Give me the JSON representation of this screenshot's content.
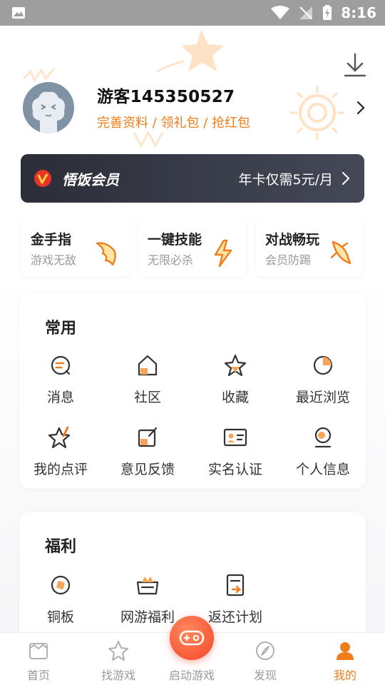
{
  "status_bar": {
    "time": "8:16"
  },
  "profile": {
    "username": "游客145350527",
    "subtitle": "完善资料 / 领礼包 / 抢红包"
  },
  "vip": {
    "title": "悟饭会员",
    "offer": "年卡仅需5元/月"
  },
  "features": [
    {
      "title": "金手指",
      "subtitle": "游戏无敌",
      "icon": "wing-icon"
    },
    {
      "title": "一键技能",
      "subtitle": "无限必杀",
      "icon": "lightning-icon"
    },
    {
      "title": "对战畅玩",
      "subtitle": "会员防踢",
      "icon": "rocket-icon"
    }
  ],
  "common": {
    "title": "常用",
    "items": [
      {
        "label": "消息",
        "icon": "message-icon"
      },
      {
        "label": "社区",
        "icon": "community-icon"
      },
      {
        "label": "收藏",
        "icon": "star-icon"
      },
      {
        "label": "最近浏览",
        "icon": "recent-icon"
      },
      {
        "label": "我的点评",
        "icon": "review-icon"
      },
      {
        "label": "意见反馈",
        "icon": "feedback-icon"
      },
      {
        "label": "实名认证",
        "icon": "id-card-icon"
      },
      {
        "label": "个人信息",
        "icon": "person-icon"
      }
    ]
  },
  "welfare": {
    "title": "福利",
    "items": [
      {
        "label": "铜板",
        "icon": "coin-icon"
      },
      {
        "label": "网游福利",
        "icon": "gift-box-icon"
      },
      {
        "label": "返还计划",
        "icon": "rebate-icon"
      }
    ]
  },
  "tabbar": {
    "tabs": [
      {
        "label": "首页",
        "icon": "home-icon"
      },
      {
        "label": "找游戏",
        "icon": "find-game-icon"
      },
      {
        "label": "启动游戏",
        "icon": "gamepad-icon"
      },
      {
        "label": "发现",
        "icon": "compass-icon"
      },
      {
        "label": "我的",
        "icon": "me-icon"
      }
    ],
    "active": "我的"
  },
  "colors": {
    "accent": "#f07d1c",
    "vip_bg": "#2b2d38",
    "launch": "#f4442a"
  }
}
